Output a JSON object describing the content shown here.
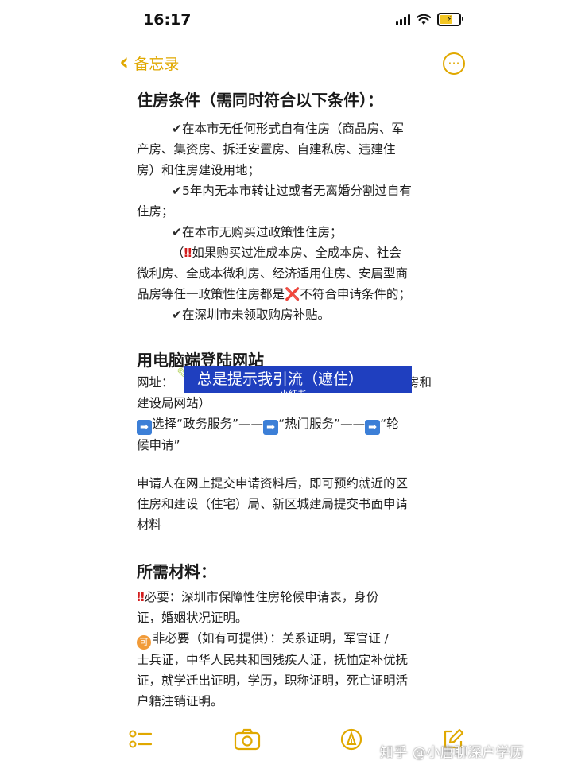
{
  "status": {
    "time": "16:17"
  },
  "nav": {
    "back_label": "备忘录",
    "more_glyph": "···"
  },
  "note": {
    "section1": {
      "heading": "住房条件（需同时符合以下条件）：",
      "item1_line1": "在本市无任何形式自有住房（商品房、军",
      "item1_line2": "产房、集资房、拆迁安置房、自建私房、违建住",
      "item1_line3": "房）和住房建设用地；",
      "item2_line1": "5年内无本市转让过或者无离婚分割过自有",
      "item2_line2": "住房；",
      "item3": "在本市无购买过政策性住房；",
      "note_line1": "（",
      "note_line1b": "如果购买过准成本房、全成本房、社会",
      "note_line2": "微利房、全成本微利房、经济适用住房、安居型商",
      "note_line3a": "品房等任一政策性住房都是",
      "note_line3b": "不符合申请条件的；",
      "item4": "在深圳市未领取购房补贴。",
      "check_glyph": "✔",
      "warn_glyph": "‼",
      "x_glyph": "❌"
    },
    "section2": {
      "heading": "用电脑端登陆网站",
      "site_prefix": "网址：",
      "site_suffix": "住房和",
      "site_line2": "建设局网站）",
      "step1": "选择“政务服务”——",
      "step2": "“热门服务”——",
      "step3": "“轮",
      "step_line2": "候申请”",
      "arrow_glyph": "➡",
      "para_line1": "申请人在网上提交申请资料后，即可预约就近的区",
      "para_line2": "住房和建设（住宅）局、新区城建局提交书面申请",
      "para_line3": "材料"
    },
    "section3": {
      "heading": "所需材料：",
      "req_line1": "必要：深圳市保障性住房轮候申请表，身份",
      "req_line2": "证，婚姻状况证明。",
      "opt_badge": "可",
      "opt_line1": "非必要（如有可提供）：关系证明，军官证 /",
      "opt_line2": "士兵证，中华人民共和国残疾人证，抚恤定补优抚",
      "opt_line3": "证，就学迁出证明，学历，职称证明，死亡证明活",
      "opt_line4": "户籍注销证明。"
    }
  },
  "overlay": {
    "banner_text": "总是提示我引流（遮住）",
    "banner_sub": "小红书"
  },
  "watermark": "知乎 @小唐聊深户学历",
  "colors": {
    "accent": "#e0a800",
    "banner": "#1f3fbf"
  }
}
